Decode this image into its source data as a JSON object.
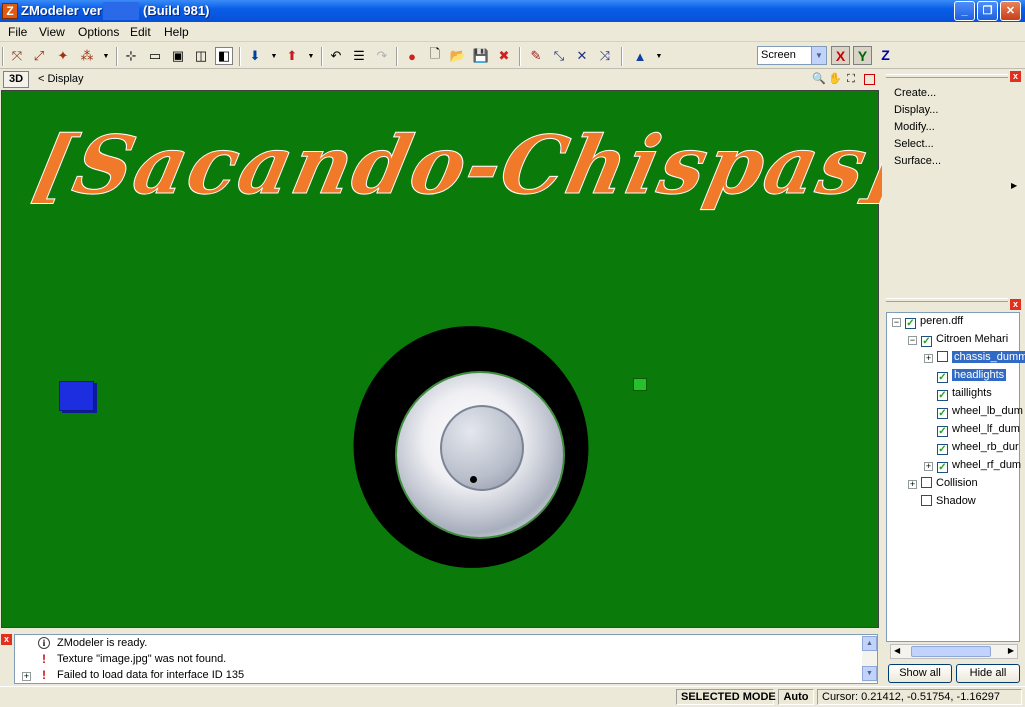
{
  "window": {
    "title": "ZModeler ver",
    "build": "(Build 981)",
    "app_icon_letter": "Z"
  },
  "menu": [
    "File",
    "View",
    "Options",
    "Edit",
    "Help"
  ],
  "toolbar": {
    "screen_select": "Screen",
    "axes": [
      "X",
      "Y",
      "Z"
    ]
  },
  "view": {
    "mode_button": "3D",
    "breadcrumb": "< Display"
  },
  "viewport": {
    "watermark": "[Sacando-Chispas]",
    "background_color": "#0a7a0a"
  },
  "commands": [
    "Create...",
    "Display...",
    "Modify...",
    "Select...",
    "Surface..."
  ],
  "tree": [
    {
      "label": "peren.dff",
      "checked": true,
      "selected": false
    },
    {
      "label": "Citroen Mehari",
      "checked": true,
      "selected": false
    },
    {
      "label": "chassis_dumm",
      "checked": false,
      "selected": true
    },
    {
      "label": "headlights",
      "checked": true,
      "selected": true
    },
    {
      "label": "taillights",
      "checked": true,
      "selected": false
    },
    {
      "label": "wheel_lb_dum",
      "checked": true,
      "selected": false
    },
    {
      "label": "wheel_lf_dum",
      "checked": true,
      "selected": false
    },
    {
      "label": "wheel_rb_dur",
      "checked": true,
      "selected": false
    },
    {
      "label": "wheel_rf_dum",
      "checked": true,
      "selected": false
    },
    {
      "label": "Collision",
      "checked": false,
      "selected": false
    },
    {
      "label": "Shadow",
      "checked": false,
      "selected": false
    }
  ],
  "tree_buttons": {
    "show": "Show all",
    "hide": "Hide all"
  },
  "log": [
    {
      "icon": "info-icon",
      "text": "ZModeler is ready."
    },
    {
      "icon": "warning-icon",
      "text": "Texture \"image.jpg\" was not found."
    },
    {
      "icon": "warning-icon",
      "text": "Failed to load data for interface ID 135"
    }
  ],
  "status": {
    "mode": "SELECTED MODE",
    "auto": "Auto",
    "cursor": "Cursor: 0.21412, -0.51754, -1.16297"
  }
}
